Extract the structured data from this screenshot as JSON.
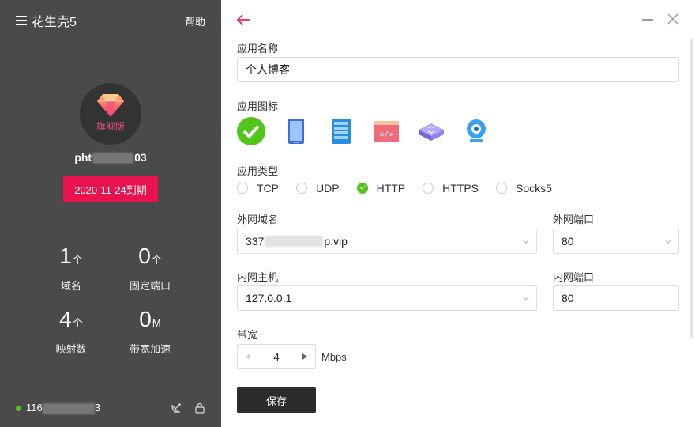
{
  "sidebar": {
    "app_title": "花生壳5",
    "help": "帮助",
    "badge_label": "旗舰版",
    "username_prefix": "pht",
    "username_suffix": "03",
    "expire_label": "2020-11-24到期",
    "stats": [
      {
        "value": "1",
        "unit": "个",
        "label": "域名"
      },
      {
        "value": "0",
        "unit": "个",
        "label": "固定端口"
      },
      {
        "value": "4",
        "unit": "个",
        "label": "映射数"
      },
      {
        "value": "0",
        "unit": "M",
        "label": "带宽加速"
      }
    ],
    "ip_prefix": "116",
    "ip_suffix": "3",
    "status_color": "#52c41a"
  },
  "form": {
    "app_name_label": "应用名称",
    "app_name_value": "个人博客",
    "app_icon_label": "应用图标",
    "icons": [
      "ie-icon",
      "phone-icon",
      "server-icon",
      "code-window-icon",
      "network-switch-icon",
      "webcam-icon"
    ],
    "app_type_label": "应用类型",
    "types": [
      "TCP",
      "UDP",
      "HTTP",
      "HTTPS",
      "Socks5"
    ],
    "selected_type": "HTTP",
    "ext_domain_label": "外网域名",
    "ext_domain_prefix": "337",
    "ext_domain_suffix": "p.vip",
    "ext_port_label": "外网端口",
    "ext_port_value": "80",
    "int_host_label": "内网主机",
    "int_host_value": "127.0.0.1",
    "int_port_label": "内网端口",
    "int_port_value": "80",
    "bandwidth_label": "带宽",
    "bandwidth_value": "4",
    "bandwidth_unit": "Mbps",
    "save_label": "保存"
  },
  "colors": {
    "accent_red": "#e8124e",
    "sidebar_bg": "#4a4a4a",
    "save_bg": "#2b2b2b"
  }
}
